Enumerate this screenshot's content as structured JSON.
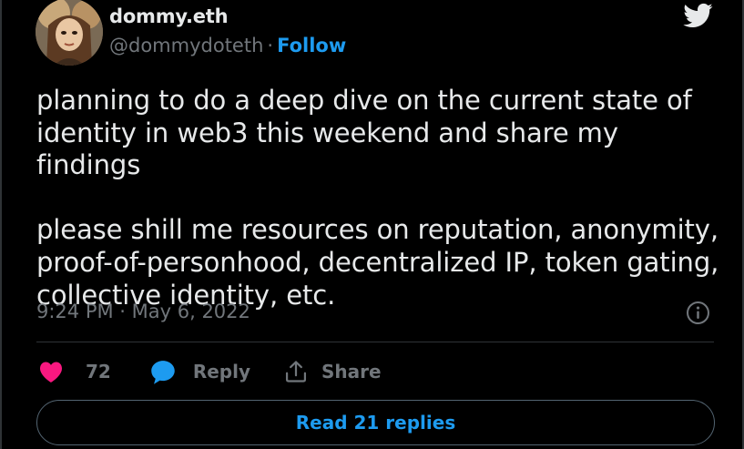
{
  "author": {
    "display_name": "dommy.eth",
    "handle": "@dommydoteth",
    "separator": "·",
    "follow_label": "Follow"
  },
  "tweet": {
    "text": "planning to do a deep dive on the current state of\nidentity in web3 this weekend and share my findings\n\nplease shill me resources on reputation, anonymity,\nproof-of-personhood, decentralized IP, token gating,\ncollective identity, etc.",
    "timestamp": "9:24 PM · May 6, 2022"
  },
  "actions": {
    "like_count": "72",
    "reply_label": "Reply",
    "share_label": "Share"
  },
  "replies_button": {
    "label": "Read 21 replies"
  },
  "colors": {
    "background": "#000000",
    "accent_blue": "#1d9bf0",
    "like_pink": "#f91880",
    "muted_text": "#71767b"
  },
  "icons": {
    "brand": "twitter-bird-icon",
    "info": "info-icon",
    "like": "heart-icon",
    "reply": "speech-bubble-icon",
    "share": "share-upload-icon"
  }
}
